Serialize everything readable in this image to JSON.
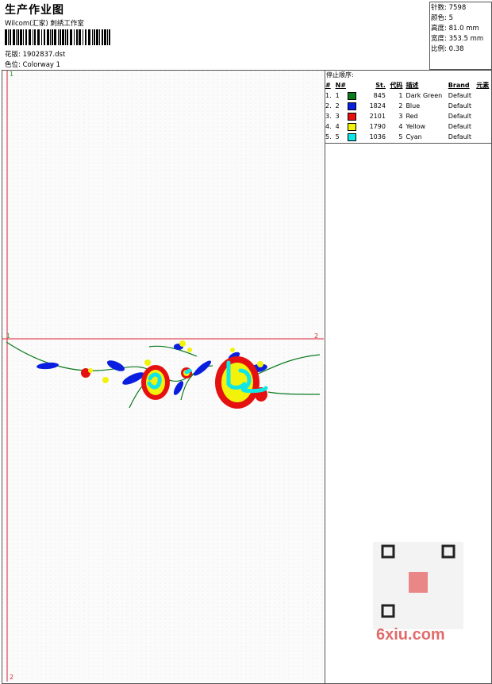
{
  "header": {
    "title": "生产作业图",
    "studio": "Wilcom(汇家) 刺绣工作室",
    "design_label": "花版:",
    "design_value": "1902837.dst",
    "colorway_label": "色位:",
    "colorway_value": "Colorway 1"
  },
  "stats": [
    {
      "label": "针数",
      "value": "7598"
    },
    {
      "label": "颜色",
      "value": "5"
    },
    {
      "label": "高度",
      "value": "81.0 mm"
    },
    {
      "label": "宽度",
      "value": "353.5 mm"
    },
    {
      "label": "比例",
      "value": "0.38"
    }
  ],
  "stop_sequence": {
    "title": "停止顺序:",
    "headers": {
      "num": "#",
      "no": "N#",
      "st": "St.",
      "code": "代码",
      "desc": "描述",
      "brand": "Brand",
      "element": "元素"
    },
    "rows": [
      {
        "num": "1.",
        "no": "1",
        "color": "#0b7a1e",
        "st": "845",
        "code": "1",
        "desc": "Dark Green",
        "brand": "Default"
      },
      {
        "num": "2.",
        "no": "2",
        "color": "#0a1ee0",
        "st": "1824",
        "code": "2",
        "desc": "Blue",
        "brand": "Default"
      },
      {
        "num": "3.",
        "no": "3",
        "color": "#e51010",
        "st": "2101",
        "code": "3",
        "desc": "Red",
        "brand": "Default"
      },
      {
        "num": "4.",
        "no": "4",
        "color": "#f2f20a",
        "st": "1790",
        "code": "4",
        "desc": "Yellow",
        "brand": "Default"
      },
      {
        "num": "5.",
        "no": "5",
        "color": "#11e6e6",
        "st": "1036",
        "code": "5",
        "desc": "Cyan",
        "brand": "Default"
      }
    ]
  },
  "guides": {
    "top_left": "1",
    "mid_left": "1",
    "mid_right": "2",
    "bottom_left": "2"
  },
  "watermark": {
    "site": "6xiu.com"
  }
}
